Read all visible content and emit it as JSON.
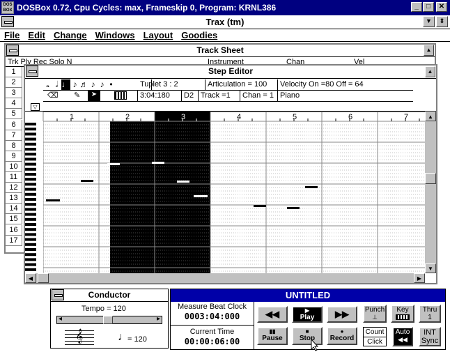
{
  "dosbox": {
    "title": "DOSBox 0.72, Cpu Cycles:      max, Frameskip  0, Program:  KRNL386",
    "logo": "DOS BOX"
  },
  "app": {
    "title": "Trax (tm)"
  },
  "menu": [
    "File",
    "Edit",
    "Change",
    "Windows",
    "Layout",
    "Goodies"
  ],
  "track_sheet": {
    "title": "Track Sheet",
    "columns": [
      "Trk",
      "Play",
      "Rec",
      "Solo",
      "Name",
      "Instrument",
      "Chan",
      "Vel"
    ],
    "header_partial": "Trk  Ply  Rec Solo  N",
    "col_instr": "Instrument",
    "col_chan": "Chan",
    "col_vel": "Vel",
    "rows": [
      "1",
      "2",
      "3",
      "4",
      "5",
      "6",
      "7",
      "8",
      "9",
      "10",
      "11",
      "12",
      "13",
      "14",
      "15",
      "16",
      "17"
    ]
  },
  "step_editor": {
    "title": "Step Editor",
    "tuplet": "Tuplet 3   :  2",
    "articulation": "Articulation =  100",
    "velocity": "Velocity On =80    Off = 64",
    "time": "3:04:180",
    "pitch": "D2",
    "track": "Track =1",
    "chan": "Chan = 1",
    "instrument": "Piano",
    "ruler": [
      "1",
      "2",
      "3",
      "4",
      "5",
      "6",
      "7"
    ]
  },
  "conductor": {
    "title": "Conductor",
    "tempo_label": "Tempo  =  120",
    "tempo_note": "= 120"
  },
  "transport": {
    "title": "UNTITLED",
    "mbc_label": "Measure  Beat  Clock",
    "mbc_value": "0003:04:000",
    "time_label": "Current Time",
    "time_value": "00:00:06:00",
    "play": "Play",
    "pause": "Pause",
    "stop": "Stop",
    "record": "Record",
    "punch": "Punch",
    "key": "Key",
    "thru": "Thru",
    "thru_val": "1",
    "count": "Count",
    "click": "Click",
    "auto": "Auto",
    "int": "INT",
    "sync": "Sync"
  }
}
